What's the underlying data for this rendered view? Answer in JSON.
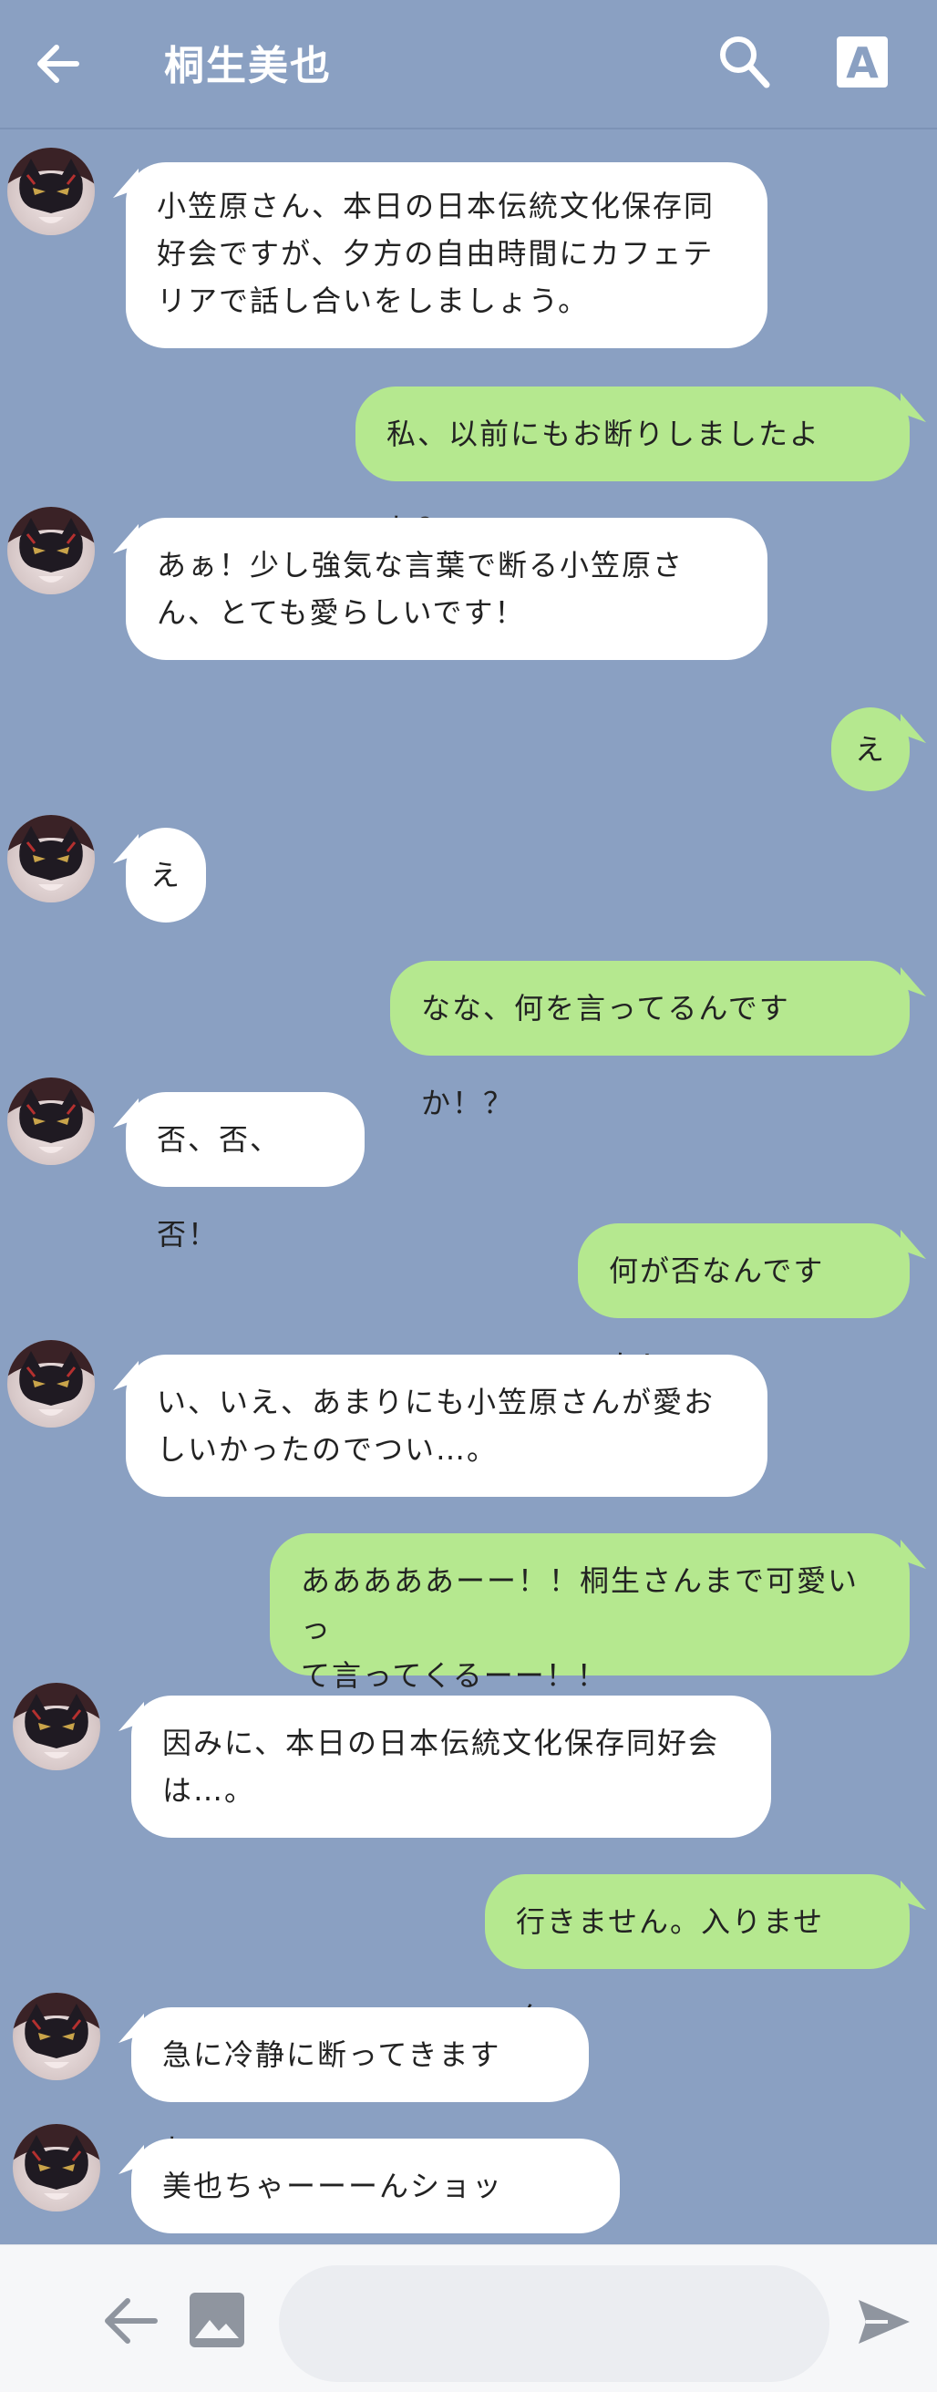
{
  "header": {
    "contact_name": "桐生美也",
    "font_button_label": "A",
    "icons": {
      "back": "arrow-left-icon",
      "search": "search-icon",
      "font": "font-size-icon"
    }
  },
  "messages": [
    {
      "sender": "other",
      "text": "小笠原さん、本日の日本伝統文化保存同\n好会ですが、夕方の自由時間にカフェテ\nリアで話し合いをしましょう。"
    },
    {
      "sender": "me",
      "text": "私、以前にもお断りしましたよね？"
    },
    {
      "sender": "other",
      "text": "あぁ！少し強気な言葉で断る小笠原さ\nん、とても愛らしいです！"
    },
    {
      "sender": "me",
      "text": "え"
    },
    {
      "sender": "other",
      "text": "え"
    },
    {
      "sender": "me",
      "text": "なな、何を言ってるんですか！？"
    },
    {
      "sender": "other",
      "text": "否、否、否！"
    },
    {
      "sender": "me",
      "text": "何が否なんですか！"
    },
    {
      "sender": "other",
      "text": "い、いえ、あまりにも小笠原さんが愛お\nしいかったのでつい…。"
    },
    {
      "sender": "me",
      "text": "あああああーー！！桐生さんまで可愛いっ\nて言ってくるーー！！"
    },
    {
      "sender": "other",
      "text": "因みに、本日の日本伝統文化保存同好会\nは…。"
    },
    {
      "sender": "me",
      "text": "行きません。入りません。"
    },
    {
      "sender": "other",
      "text": "急に冷静に断ってきますね。"
    },
    {
      "sender": "other",
      "text": "美也ちゃーーーんショック！！"
    }
  ],
  "footer": {
    "icons": {
      "back": "arrow-left-icon",
      "image": "image-icon",
      "send": "send-icon"
    },
    "input_placeholder": ""
  },
  "colors": {
    "background": "#8aa0c2",
    "incoming_bubble": "#ffffff",
    "outgoing_bubble": "#b5e88f",
    "footer": "#f6f7f9"
  }
}
